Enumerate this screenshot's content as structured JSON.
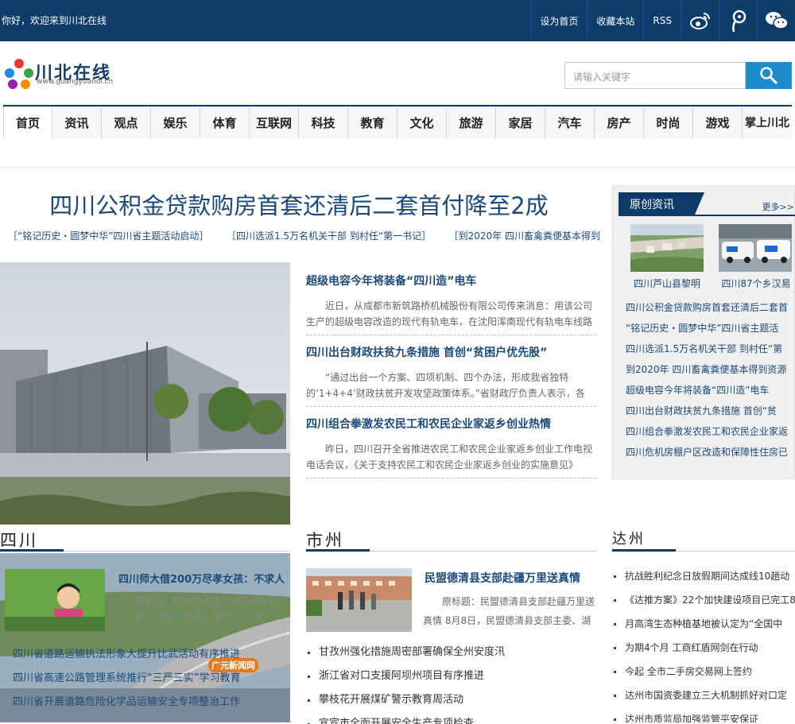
{
  "topbar": {
    "welcome": "你好，欢迎来到川北在线",
    "links": [
      "设为首页",
      "收藏本站",
      "RSS"
    ],
    "social_icons": [
      "weibo-icon",
      "tencent-weibo-icon",
      "wechat-icon"
    ]
  },
  "logo": {
    "name": "川北在线",
    "url_text": "www.guangyuanol.cn"
  },
  "search": {
    "placeholder": "请输入关键字"
  },
  "nav": [
    "首页",
    "资讯",
    "观点",
    "娱乐",
    "体育",
    "互联网",
    "科技",
    "教育",
    "文化",
    "旅游",
    "家居",
    "汽车",
    "房产",
    "时尚",
    "游戏",
    "掌上川北"
  ],
  "headline": {
    "title": "四川公积金贷款购房首套还清后二套首付降至2成",
    "sublinks": [
      "［“铭记历史・圆梦中华”四川省主题活动启动］",
      "［四川选派1.5万名机关干部 到村任“第一书记］",
      "［到2020年 四川畜禽粪便基本得到"
    ]
  },
  "news": [
    {
      "title": "超级电容今年将装备“四川造”电车",
      "desc": "近日，从成都市新筑路桥机械股份有限公司传来消息：用该公司生产的超级电容改造的现代有轨电车，在沈阳浑南现代有轨电车线路"
    },
    {
      "title": "四川出台财政扶贫九条措施 首创“贫困户优先股”",
      "desc": "“通过出台一个方案、四项机制、四个办法，形成我省独特的‘1+4+4’财政扶贫开发攻坚政策体系。”省财政厅负责人表示，各"
    },
    {
      "title": "四川组合拳激发农民工和农民企业家返乡创业热情",
      "desc": "昨日，四川召开全省推进农民工和农民企业家返乡创业工作电视电话会议，《关于支持农民工和农民企业家返乡创业的实施意见》"
    }
  ],
  "sidebar": {
    "title": "原创资讯",
    "more": "更多>>",
    "captions": [
      "四川芦山县黎明",
      "四川87个乡汉易"
    ],
    "items": [
      "四川公积金贷款购房首套还清后二套首",
      "“铭记历史・圆梦中华”四川省主题活",
      "四川选派1.5万名机关干部 到村任“第",
      "到2020年 四川畜禽粪便基本得到资源",
      "超级电容今年将装备“四川造”电车",
      "四川出台财政扶贫九条措施 首创“贫",
      "四川组合拳激发农民工和农民企业家返",
      "四川危机房棚户区改造和保障性住房已"
    ]
  },
  "sichuan": {
    "title": "四川",
    "feature_title": "四川师大借200万尽孝女孩：不求人",
    "feature_desc": "原标题：四川师大借200万尽孝女孩：不求人生活... 近日，川师",
    "links": [
      "四川省道路运输执法形象大提升比武活动有序推进",
      "四川省高速公路管理系统推行“三严三实”学习教育",
      "四川省开展道路危险化学品运输安全专项整治工作"
    ],
    "watermark": "广元新闻网"
  },
  "shizhou": {
    "title": "市州",
    "feature_title": "民盟德清县支部赴疆万里送真情",
    "feature_desc": "原标题：民盟德清县支部赴疆万里送真情 8月8日，民盟德清县支部主委、湖",
    "items": [
      "甘孜州强化措施周密部署确保全州安度汛",
      "浙江省对口支援阿坝州项目有序推进",
      "攀枝花开展煤矿警示教育周活动",
      "宜宾市全面开展安全生产专项检查"
    ]
  },
  "dazhou": {
    "title": "达州",
    "items": [
      "抗战胜利纪念日放假期间达成线10趟动",
      "《达推方案》22个加快建设项目已完工8",
      "月高湾生态种植基地被认定为“全国中",
      "为期4个月 工商红盾网剑在行动",
      "今起 全市二手房交易网上签约",
      "达州市国资委建立三大机制抓好对口定",
      "达州市质监局加强监管平安保证"
    ]
  },
  "colors": {
    "primary": "#0d3c6a",
    "link": "#1b4a7a",
    "search_btn": "#1e8bcd"
  }
}
